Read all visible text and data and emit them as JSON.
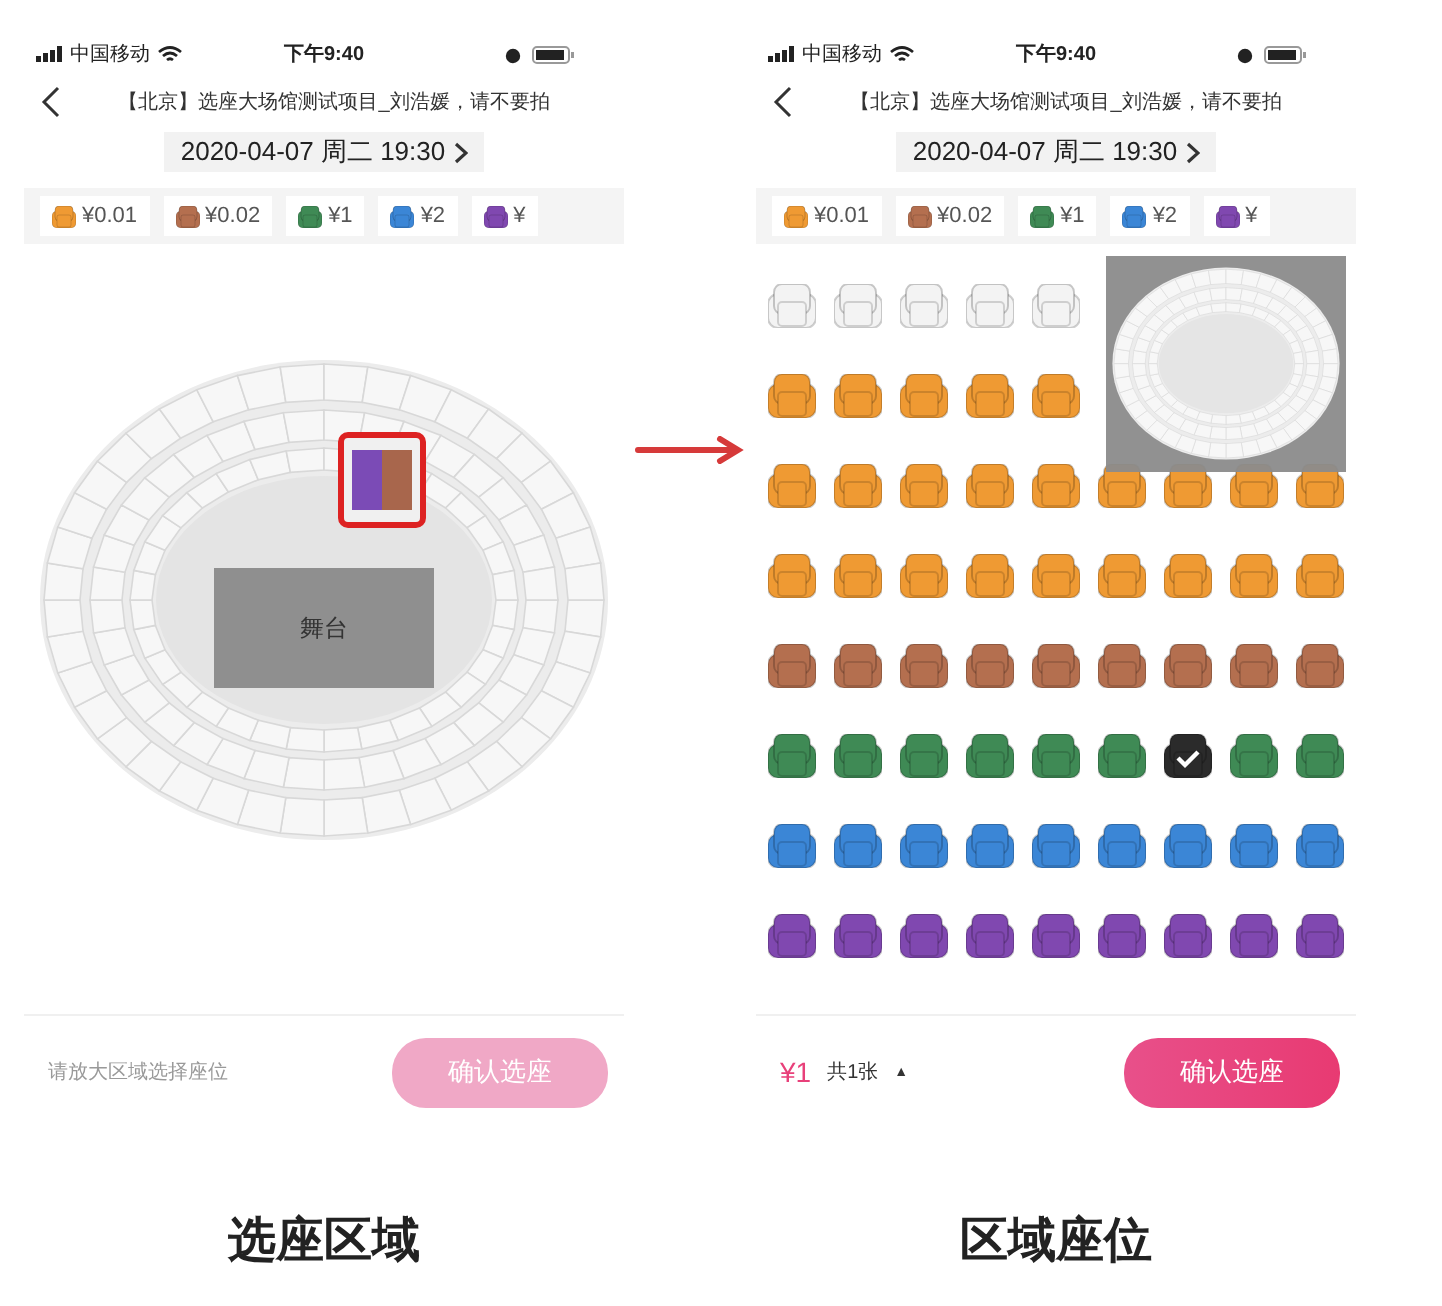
{
  "screens": [
    {
      "kind": "map",
      "status_bar": {
        "carrier": "中国移动",
        "time": "下午9:40"
      },
      "nav": {
        "title": "【北京】选座大场馆测试项目_刘浩媛，请不要拍"
      },
      "date": "2020-04-07 周二 19:30",
      "price_chips": [
        {
          "label": "¥0.01",
          "color": "#ef9a33"
        },
        {
          "label": "¥0.02",
          "color": "#b46f4f"
        },
        {
          "label": "¥1",
          "color": "#3f8a55"
        },
        {
          "label": "¥2",
          "color": "#3b86d6"
        },
        {
          "label": "¥",
          "color": "#8048b0"
        }
      ],
      "map": {
        "stage_label": "舞台"
      },
      "footer": {
        "hint": "请放大区域选择座位",
        "button": {
          "label": "确认选座",
          "disabled": true
        }
      },
      "caption": "选座区域"
    },
    {
      "kind": "seats",
      "status_bar": {
        "carrier": "中国移动",
        "time": "下午9:40"
      },
      "nav": {
        "title": "【北京】选座大场馆测试项目_刘浩媛，请不要拍"
      },
      "date": "2020-04-07 周二 19:30",
      "price_chips": [
        {
          "label": "¥0.01",
          "color": "#ef9a33"
        },
        {
          "label": "¥0.02",
          "color": "#b46f4f"
        },
        {
          "label": "¥1",
          "color": "#3f8a55"
        },
        {
          "label": "¥2",
          "color": "#3b86d6"
        },
        {
          "label": "¥",
          "color": "#8048b0"
        }
      ],
      "seat_rows": [
        {
          "available": false,
          "seats": [
            {
              "selected": false
            },
            {
              "selected": false
            },
            {
              "selected": false
            },
            {
              "selected": false
            },
            {
              "selected": false
            }
          ]
        },
        {
          "available": true,
          "color": "#ef9a33",
          "seats": [
            {
              "selected": false
            },
            {
              "selected": false
            },
            {
              "selected": false
            },
            {
              "selected": false
            },
            {
              "selected": false
            }
          ]
        },
        {
          "available": true,
          "color": "#ef9a33",
          "seats": [
            {
              "selected": false
            },
            {
              "selected": false
            },
            {
              "selected": false
            },
            {
              "selected": false
            },
            {
              "selected": false
            },
            {
              "selected": false
            },
            {
              "selected": false
            },
            {
              "selected": false
            },
            {
              "selected": false
            }
          ]
        },
        {
          "available": true,
          "color": "#ef9a33",
          "seats": [
            {
              "selected": false
            },
            {
              "selected": false
            },
            {
              "selected": false
            },
            {
              "selected": false
            },
            {
              "selected": false
            },
            {
              "selected": false
            },
            {
              "selected": false
            },
            {
              "selected": false
            },
            {
              "selected": false
            }
          ]
        },
        {
          "available": true,
          "color": "#b46f4f",
          "seats": [
            {
              "selected": false
            },
            {
              "selected": false
            },
            {
              "selected": false
            },
            {
              "selected": false
            },
            {
              "selected": false
            },
            {
              "selected": false
            },
            {
              "selected": false
            },
            {
              "selected": false
            },
            {
              "selected": false
            }
          ]
        },
        {
          "available": true,
          "color": "#3f8a55",
          "seats": [
            {
              "selected": false
            },
            {
              "selected": false
            },
            {
              "selected": false
            },
            {
              "selected": false
            },
            {
              "selected": false
            },
            {
              "selected": false
            },
            {
              "selected": true
            },
            {
              "selected": false
            },
            {
              "selected": false
            }
          ]
        },
        {
          "available": true,
          "color": "#3b86d6",
          "seats": [
            {
              "selected": false
            },
            {
              "selected": false
            },
            {
              "selected": false
            },
            {
              "selected": false
            },
            {
              "selected": false
            },
            {
              "selected": false
            },
            {
              "selected": false
            },
            {
              "selected": false
            },
            {
              "selected": false
            }
          ]
        },
        {
          "available": true,
          "color": "#8048b0",
          "seats": [
            {
              "selected": false
            },
            {
              "selected": false
            },
            {
              "selected": false
            },
            {
              "selected": false
            },
            {
              "selected": false
            },
            {
              "selected": false
            },
            {
              "selected": false
            },
            {
              "selected": false
            },
            {
              "selected": false
            }
          ]
        }
      ],
      "footer": {
        "price": "¥1",
        "count": "共1张",
        "caret": "▲",
        "button": {
          "label": "确认选座",
          "disabled": false
        }
      },
      "caption": "区域座位"
    }
  ]
}
